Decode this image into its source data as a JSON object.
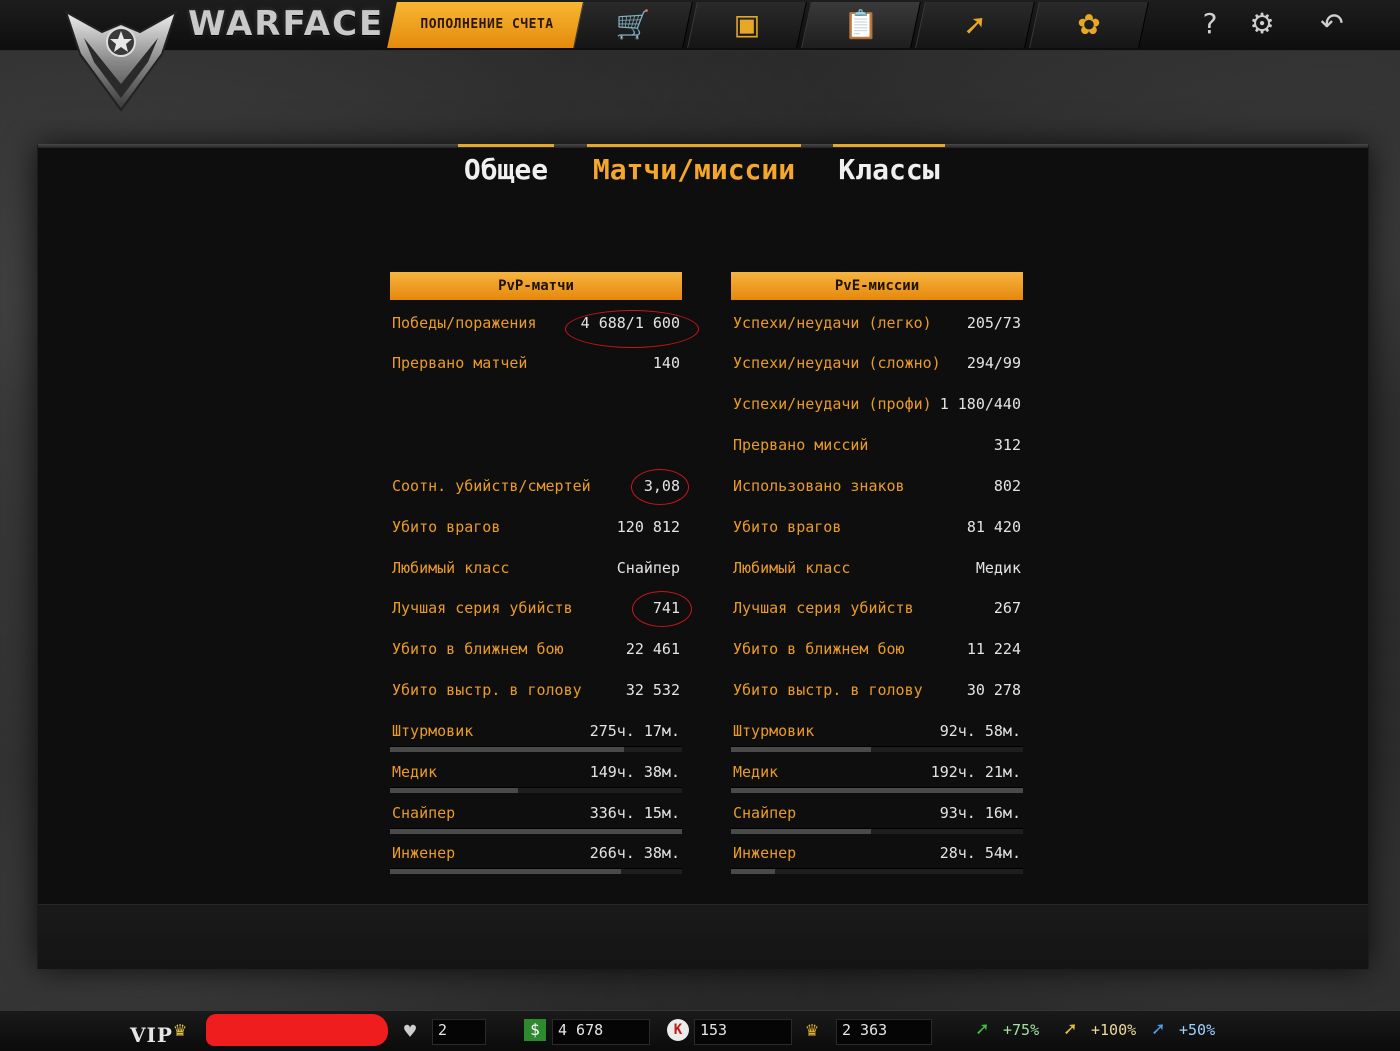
{
  "header": {
    "brand": "WARFACE",
    "topup_label": "ПОПОЛНЕНИЕ СЧЕТА",
    "nav_icons": [
      "shop-cart-icon",
      "inventory-box-icon",
      "stats-clipboard-icon",
      "achievements-icon",
      "clan-emblem-icon"
    ],
    "help_symbol": "?",
    "settings_symbol": "⚙",
    "exit_symbol": "↶"
  },
  "tabs": [
    {
      "label": "Общее",
      "active": false
    },
    {
      "label": "Матчи/миссии",
      "active": true
    },
    {
      "label": "Классы",
      "active": false
    }
  ],
  "pvp": {
    "title": "PvP-матчи",
    "rows": [
      {
        "label": "Победы/поражения",
        "value": "4 688/1 600"
      },
      {
        "label": "Прервано матчей",
        "value": "140"
      },
      {
        "label": "Соотн. убийств/смертей",
        "value": "3,08"
      },
      {
        "label": "Убито врагов",
        "value": "120 812"
      },
      {
        "label": "Любимый класс",
        "value": "Снайпер"
      },
      {
        "label": "Лучшая серия убийств",
        "value": "741"
      },
      {
        "label": "Убито в ближнем бою",
        "value": "22 461"
      },
      {
        "label": "Убито выстр. в голову",
        "value": "32 532"
      }
    ],
    "classes": [
      {
        "label": "Штурмовик",
        "value": "275ч. 17м.",
        "progress": 0.8
      },
      {
        "label": "Медик",
        "value": "149ч. 38м.",
        "progress": 0.44
      },
      {
        "label": "Снайпер",
        "value": "336ч. 15м.",
        "progress": 1.0
      },
      {
        "label": "Инженер",
        "value": "266ч. 38м.",
        "progress": 0.79
      }
    ]
  },
  "pve": {
    "title": "PvE-миссии",
    "rows": [
      {
        "label": "Успехи/неудачи (легко)",
        "value": "205/73"
      },
      {
        "label": "Успехи/неудачи (сложно)",
        "value": "294/99"
      },
      {
        "label": "Успехи/неудачи (профи)",
        "value": "1 180/440"
      },
      {
        "label": "Прервано миссий",
        "value": "312"
      },
      {
        "label": "Использовано знаков",
        "value": "802"
      },
      {
        "label": "Убито врагов",
        "value": "81 420"
      },
      {
        "label": "Любимый класс",
        "value": "Медик"
      },
      {
        "label": "Лучшая серия убийств",
        "value": "267"
      },
      {
        "label": "Убито в ближнем бою",
        "value": "11 224"
      },
      {
        "label": "Убито выстр. в голову",
        "value": "30 278"
      }
    ],
    "classes": [
      {
        "label": "Штурмовик",
        "value": "92ч. 58м.",
        "progress": 0.48
      },
      {
        "label": "Медик",
        "value": "192ч. 21м.",
        "progress": 1.0
      },
      {
        "label": "Снайпер",
        "value": "93ч. 16м.",
        "progress": 0.48
      },
      {
        "label": "Инженер",
        "value": "28ч. 54м.",
        "progress": 0.15
      }
    ]
  },
  "status": {
    "vip": "VIP",
    "rank_icon": "rank-insignia-icon",
    "player_name": "",
    "friends_count": "2",
    "money": "4 678",
    "kredits": "153",
    "crowns": "2 363",
    "boost_xp": "+75%",
    "boost_money": "+100%",
    "boost_vp": "+50%"
  },
  "colors": {
    "accent": "#e99b27",
    "header_orange": "#f0a030",
    "circle_red": "#c9161b"
  }
}
